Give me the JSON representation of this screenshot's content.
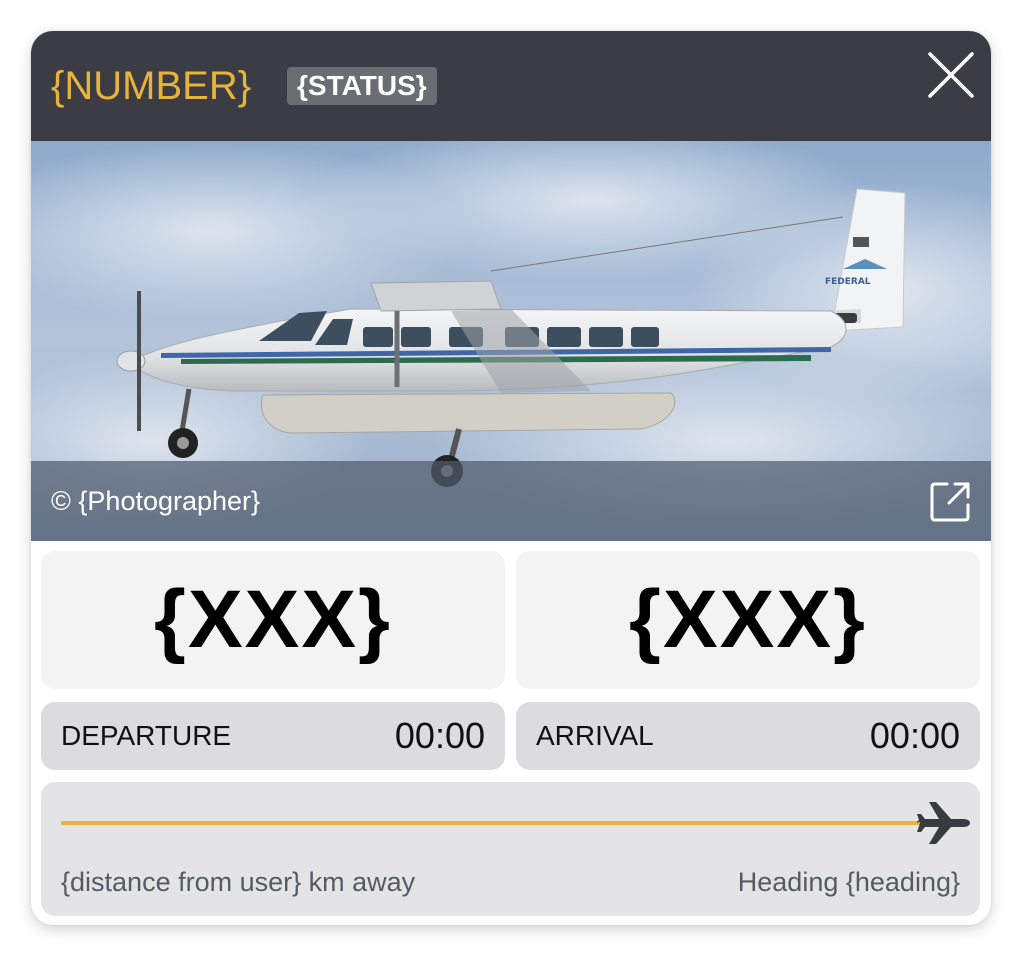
{
  "header": {
    "flight_number": "{NUMBER}",
    "status": "{STATUS}",
    "close_icon": "close-icon"
  },
  "photo": {
    "copyright": "© {Photographer}",
    "link_icon": "external-link-icon"
  },
  "departure": {
    "code": "{XXX}",
    "label": "DEPARTURE",
    "time": "00:00"
  },
  "arrival": {
    "code": "{XXX}",
    "label": "ARRIVAL",
    "time": "00:00"
  },
  "progress": {
    "fraction": 1.0,
    "icon": "plane-icon",
    "distance": "{distance from user} km away",
    "heading": "Heading {heading}"
  },
  "colors": {
    "header_bg": "#3c3d44",
    "accent": "#e8b33a",
    "badge_bg": "#6c6d73"
  }
}
